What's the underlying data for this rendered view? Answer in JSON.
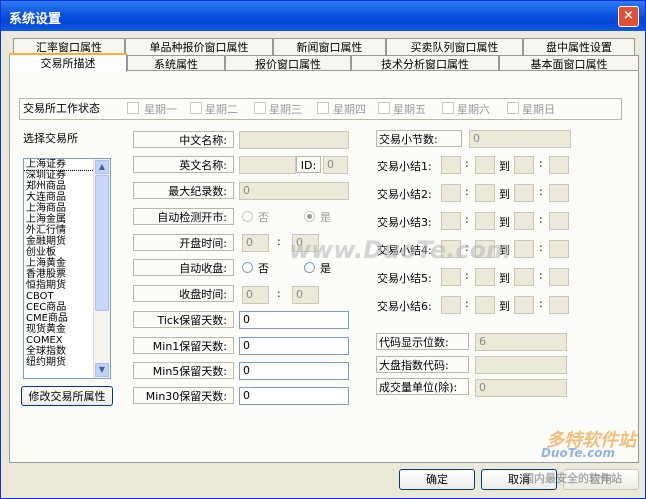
{
  "window": {
    "title": "系统设置",
    "close": "×"
  },
  "tabs_row1": [
    "汇率窗口属性",
    "单品种报价窗口属性",
    "新闻窗口属性",
    "买卖队列窗口属性",
    "盘中属性设置"
  ],
  "tabs_row2": [
    "交易所描述",
    "系统属性",
    "报价窗口属性",
    "技术分析窗口属性",
    "基本面窗口属性"
  ],
  "workdays": {
    "label": "交易所工作状态",
    "days": [
      "星期一",
      "星期二",
      "星期三",
      "星期四",
      "星期五",
      "星期六",
      "星期日"
    ]
  },
  "exchange": {
    "label": "选择交易所",
    "items": [
      "上海证券",
      "深圳证券",
      "郑州商品",
      "大连商品",
      "上海商品",
      "上海金属",
      "外汇行情",
      "金融期货",
      "创业板",
      "上海黄金",
      "香港股票",
      "恒指期货",
      "CBOT",
      "CEC商品",
      "CME商品",
      "现货黄金",
      "COMEX",
      "全球指数",
      "纽约期货"
    ],
    "modify_button": "修改交易所属性"
  },
  "form": {
    "cn_name": "中文名称:",
    "en_name": "英文名称:",
    "id_label": "ID:",
    "id_value": "0",
    "max_records": "最大纪录数:",
    "max_records_value": "0",
    "auto_detect": "自动检测开市:",
    "no": "否",
    "yes": "是",
    "open_time": "开盘时间:",
    "open_h": "0",
    "open_m": "0",
    "auto_close": "自动收盘:",
    "close_time": "收盘时间:",
    "close_h": "0",
    "close_m": "0",
    "tick_days": "Tick保留天数:",
    "tick_value": "0",
    "min1_days": "Min1保留天数:",
    "min1_value": "0",
    "min5_days": "Min5保留天数:",
    "min5_value": "0",
    "min30_days": "Min30保留天数:",
    "min30_value": "0"
  },
  "sessions": {
    "count_label": "交易小节数:",
    "count_value": "0",
    "to": "到",
    "rows": [
      "交易小结1:",
      "交易小结2:",
      "交易小结3:",
      "交易小结4:",
      "交易小结5:",
      "交易小结6:"
    ]
  },
  "bottom_right": {
    "code_digits": "代码显示位数:",
    "code_digits_value": "6",
    "index_code": "大盘指数代码:",
    "volume_unit": "成交量单位(除):",
    "volume_unit_value": "0"
  },
  "buttons": {
    "ok": "确定",
    "cancel": "取消",
    "apply": "应用"
  },
  "watermark": {
    "text1": "www.DuoTe.com",
    "text2": "多特软件站",
    "text3": "DuoTe.com",
    "text4": "国内最安全的软件站"
  }
}
